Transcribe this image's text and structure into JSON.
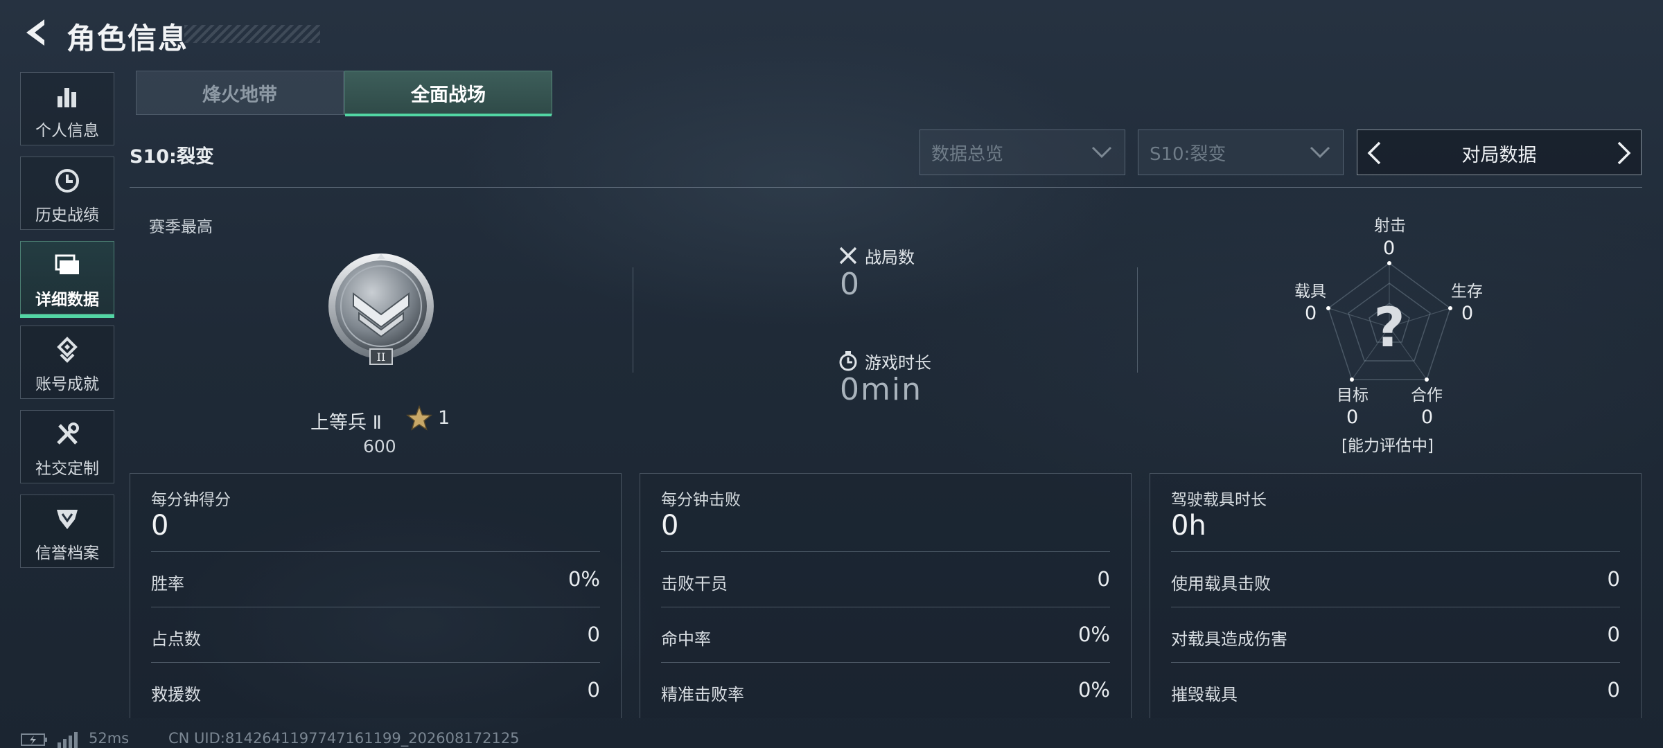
{
  "header": {
    "title": "角色信息"
  },
  "sidebar": {
    "items": [
      {
        "label": "个人信息",
        "icon": "bar-chart-icon"
      },
      {
        "label": "历史战绩",
        "icon": "history-icon"
      },
      {
        "label": "详细数据",
        "icon": "folder-icon",
        "active": true
      },
      {
        "label": "账号成就",
        "icon": "achievement-icon"
      },
      {
        "label": "社交定制",
        "icon": "tools-icon"
      },
      {
        "label": "信誉档案",
        "icon": "shield-icon"
      }
    ]
  },
  "mode_tabs": [
    {
      "label": "烽火地带"
    },
    {
      "label": "全面战场",
      "active": true
    }
  ],
  "season": {
    "label": "S10:裂变"
  },
  "filters": {
    "overview": {
      "value": "数据总览"
    },
    "season": {
      "value": "S10:裂变"
    },
    "switcher": {
      "label": "对局数据"
    }
  },
  "season_best": {
    "label": "赛季最高",
    "rank_name": "上等兵 Ⅱ",
    "stars": "1",
    "points": "600",
    "badge_numeral": "II"
  },
  "matches": {
    "count_label": "战局数",
    "count_value": "0",
    "time_label": "游戏时长",
    "time_value": "0min"
  },
  "radar": {
    "axes": [
      {
        "label": "射击",
        "value": "0"
      },
      {
        "label": "生存",
        "value": "0"
      },
      {
        "label": "合作",
        "value": "0"
      },
      {
        "label": "目标",
        "value": "0"
      },
      {
        "label": "载具",
        "value": "0"
      }
    ],
    "center_symbol": "?",
    "status": "[能力评估中]"
  },
  "panels": [
    {
      "title": "每分钟得分",
      "value": "0",
      "rows": [
        {
          "label": "胜率",
          "value": "0%"
        },
        {
          "label": "占点数",
          "value": "0"
        },
        {
          "label": "救援数",
          "value": "0"
        }
      ]
    },
    {
      "title": "每分钟击败",
      "value": "0",
      "rows": [
        {
          "label": "击败干员",
          "value": "0"
        },
        {
          "label": "命中率",
          "value": "0%"
        },
        {
          "label": "精准击败率",
          "value": "0%"
        }
      ]
    },
    {
      "title": "驾驶载具时长",
      "value": "0h",
      "rows": [
        {
          "label": "使用载具击败",
          "value": "0"
        },
        {
          "label": "对载具造成伤害",
          "value": "0"
        },
        {
          "label": "摧毁载具",
          "value": "0"
        }
      ]
    }
  ],
  "footer": {
    "ping": "52ms",
    "uid": "CN UID:8142641197747161199_202608172125"
  },
  "colors": {
    "accent": "#52d6a4",
    "background": "#1f2a37"
  }
}
